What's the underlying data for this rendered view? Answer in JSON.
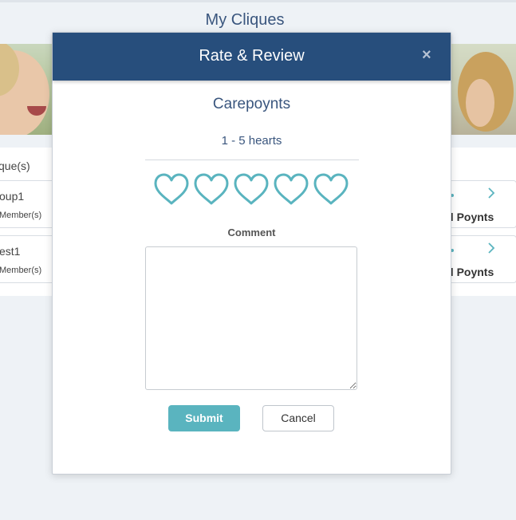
{
  "page": {
    "title": "My Cliques",
    "cliques_label": "que(s)",
    "cards": [
      {
        "name": "oup1",
        "members": "Member(s)",
        "poynts": "al Poynts"
      },
      {
        "name": "est1",
        "members": "Member(s)",
        "poynts": "al Poynts"
      }
    ]
  },
  "modal": {
    "title": "Rate & Review",
    "close_glyph": "×",
    "subtitle": "Carepoynts",
    "rating_hint": "1 - 5 hearts",
    "heart_count": 5,
    "comment_label": "Comment",
    "comment_value": "",
    "submit_label": "Submit",
    "cancel_label": "Cancel"
  },
  "colors": {
    "header": "#274e7c",
    "accent": "#5ab4bf",
    "text_blue": "#3a567e"
  },
  "icons": {
    "heart": "heart-outline-icon",
    "close": "close-icon",
    "chevron": "chevron-right-icon"
  }
}
